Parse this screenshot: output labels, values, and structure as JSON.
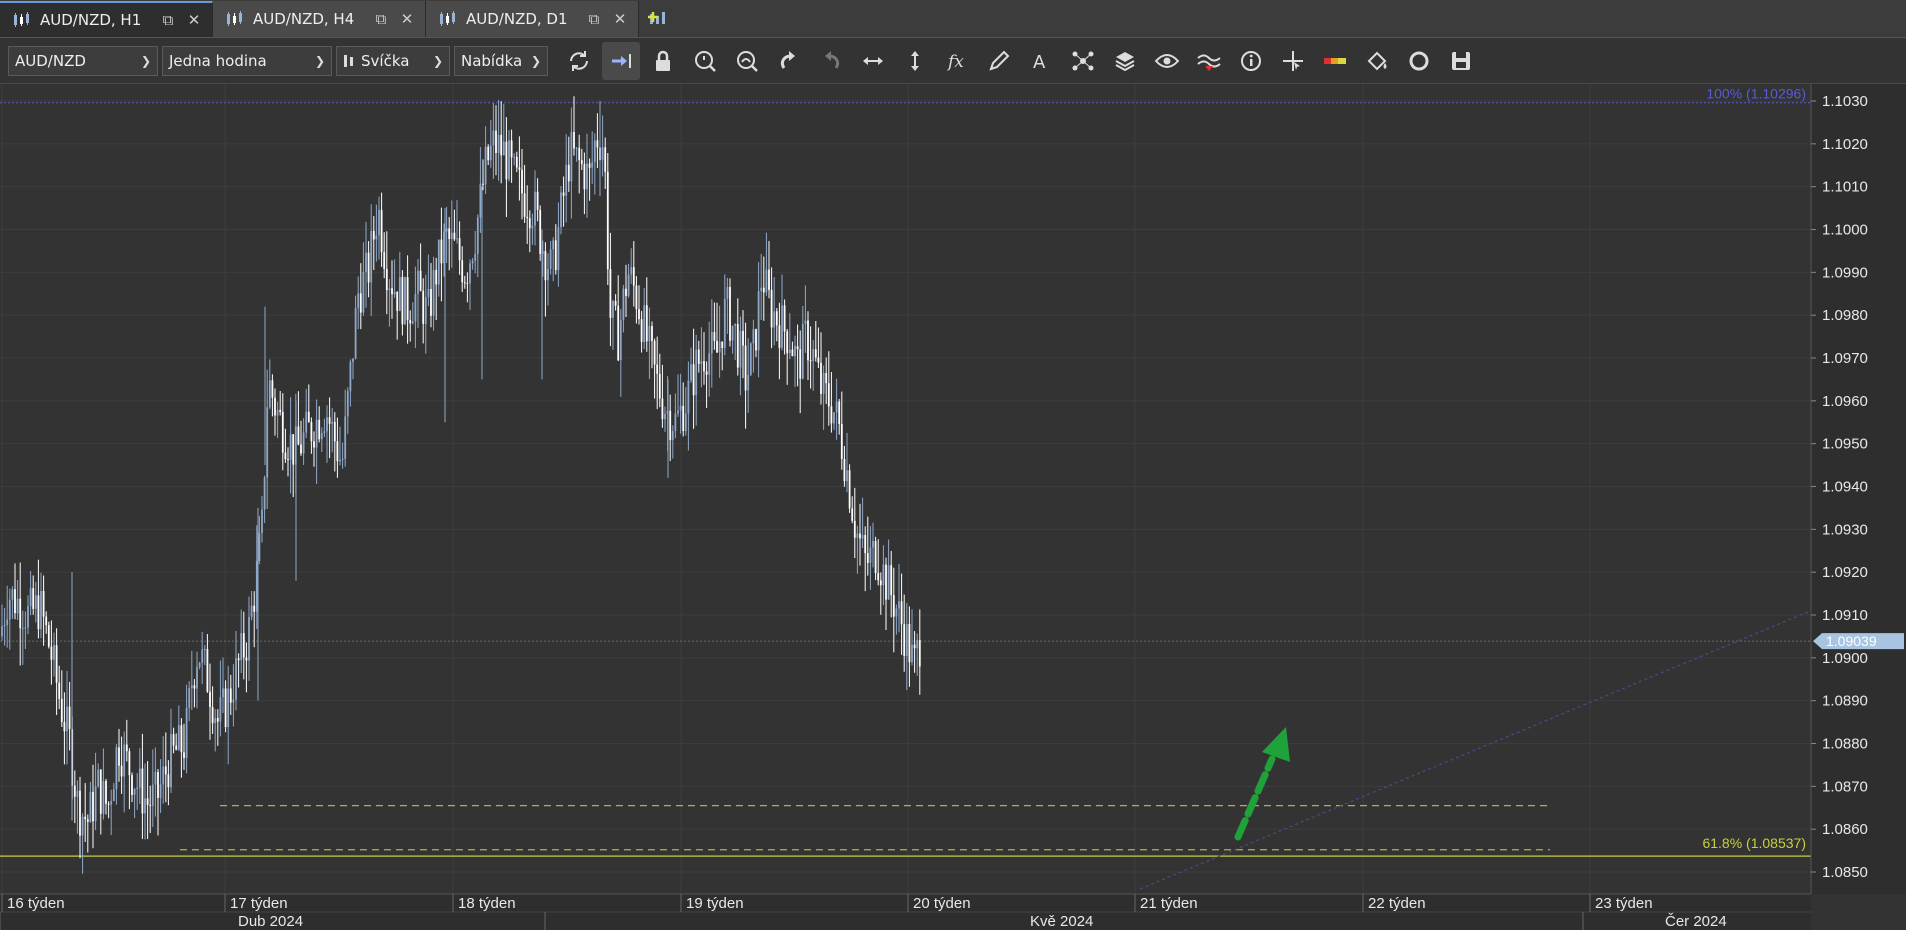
{
  "tabs": [
    {
      "label": "AUD/NZD, H1",
      "active": true
    },
    {
      "label": "AUD/NZD, H4",
      "active": false
    },
    {
      "label": "AUD/NZD, D1",
      "active": false
    }
  ],
  "toolbar": {
    "instrument": "AUD/NZD",
    "period": "Jedna hodina",
    "chart_type": "Svíčka",
    "offer_side": "Nabídka"
  },
  "icons": [
    "refresh-icon",
    "shift-chart-icon",
    "lock-icon",
    "zoom-in-icon",
    "zoom-out-icon",
    "undo-icon",
    "redo-icon",
    "fit-horizontal-icon",
    "fit-vertical-icon",
    "indicators-icon",
    "pencil-icon",
    "text-icon",
    "objects-icon",
    "layers-icon",
    "eye-icon",
    "signals-icon",
    "info-icon",
    "crosshair-icon",
    "ruler-icon",
    "theme-icon",
    "reset-icon",
    "save-icon"
  ],
  "colors": {
    "background": "#333333",
    "candle_up": "#8fa8c8",
    "candle_down": "#ffffff",
    "fib_100": "#5a5ad8",
    "fib_618": "#c8d040",
    "current_price_bg": "#a8c4e0",
    "arrow": "#1fa23a"
  },
  "chart_data": {
    "type": "candlestick",
    "price_labels": [
      "1.1030",
      "1.1020",
      "1.1010",
      "1.1000",
      "1.0990",
      "1.0980",
      "1.0970",
      "1.0960",
      "1.0950",
      "1.0940",
      "1.0930",
      "1.0920",
      "1.0910",
      "1.0900",
      "1.0890",
      "1.0880",
      "1.0870",
      "1.0860",
      "1.0850"
    ],
    "ylim": [
      1.0845,
      1.1035
    ],
    "current_price": "1.09039",
    "fib_100_label": "100% (1.10296)",
    "fib_100_value": 1.10296,
    "fib_618_label": "61.8% (1.08537)",
    "fib_618_value": 1.08537,
    "weeks": [
      "16 týden",
      "17 týden",
      "18 týden",
      "19 týden",
      "20 týden",
      "21 týden",
      "22 týden",
      "23 týden"
    ],
    "months": [
      "Dub 2024",
      "Kvě 2024",
      "Čer 2024"
    ],
    "path": [
      [
        0,
        1.0905
      ],
      [
        8,
        1.0915
      ],
      [
        18,
        1.0913
      ],
      [
        28,
        1.091
      ],
      [
        40,
        1.0912
      ],
      [
        52,
        1.09
      ],
      [
        60,
        1.089
      ],
      [
        70,
        1.088
      ],
      [
        78,
        1.0865
      ],
      [
        88,
        1.0862
      ],
      [
        98,
        1.087
      ],
      [
        108,
        1.0865
      ],
      [
        118,
        1.088
      ],
      [
        128,
        1.0875
      ],
      [
        138,
        1.087
      ],
      [
        148,
        1.0866
      ],
      [
        158,
        1.0868
      ],
      [
        168,
        1.0875
      ],
      [
        175,
        1.0878
      ],
      [
        185,
        1.088
      ],
      [
        192,
        1.0895
      ],
      [
        198,
        1.0902
      ],
      [
        208,
        1.0895
      ],
      [
        218,
        1.0885
      ],
      [
        228,
        1.089
      ],
      [
        238,
        1.0898
      ],
      [
        248,
        1.0905
      ],
      [
        256,
        1.0918
      ],
      [
        262,
        1.093
      ],
      [
        268,
        1.0965
      ],
      [
        276,
        1.0958
      ],
      [
        286,
        1.0952
      ],
      [
        296,
        1.0948
      ],
      [
        306,
        1.0952
      ],
      [
        316,
        1.0955
      ],
      [
        326,
        1.0958
      ],
      [
        336,
        1.095
      ],
      [
        342,
        1.0945
      ],
      [
        350,
        1.0965
      ],
      [
        358,
        1.0985
      ],
      [
        368,
        1.099
      ],
      [
        378,
        1.1005
      ],
      [
        388,
        1.099
      ],
      [
        398,
        1.0985
      ],
      [
        408,
        1.0982
      ],
      [
        418,
        1.0985
      ],
      [
        428,
        1.098
      ],
      [
        436,
        1.099
      ],
      [
        446,
        1.0998
      ],
      [
        456,
        1.0995
      ],
      [
        466,
        1.099
      ],
      [
        476,
        1.1
      ],
      [
        486,
        1.1015
      ],
      [
        494,
        1.102
      ],
      [
        504,
        1.1018
      ],
      [
        514,
        1.1012
      ],
      [
        524,
        1.1008
      ],
      [
        534,
        1.1005
      ],
      [
        544,
        1.0995
      ],
      [
        552,
        1.099
      ],
      [
        560,
        1.1002
      ],
      [
        570,
        1.1018
      ],
      [
        580,
        1.1015
      ],
      [
        590,
        1.1012
      ],
      [
        596,
        1.1022
      ],
      [
        604,
        1.102
      ],
      [
        610,
        1.098
      ],
      [
        618,
        1.0975
      ],
      [
        628,
        1.099
      ],
      [
        636,
        1.0985
      ],
      [
        646,
        1.0975
      ],
      [
        656,
        1.0965
      ],
      [
        666,
        1.0958
      ],
      [
        676,
        1.0955
      ],
      [
        686,
        1.096
      ],
      [
        696,
        1.0968
      ],
      [
        706,
        1.0972
      ],
      [
        716,
        1.097
      ],
      [
        726,
        1.0982
      ],
      [
        736,
        1.0975
      ],
      [
        746,
        1.0965
      ],
      [
        754,
        1.0972
      ],
      [
        762,
        1.099
      ],
      [
        770,
        1.0982
      ],
      [
        780,
        1.0978
      ],
      [
        790,
        1.0975
      ],
      [
        798,
        1.0968
      ],
      [
        806,
        1.0975
      ],
      [
        814,
        1.097
      ],
      [
        822,
        1.0962
      ],
      [
        830,
        1.096
      ],
      [
        838,
        1.0955
      ],
      [
        846,
        1.0945
      ],
      [
        856,
        1.093
      ],
      [
        866,
        1.0922
      ],
      [
        876,
        1.0925
      ],
      [
        886,
        1.0918
      ],
      [
        896,
        1.0912
      ],
      [
        906,
        1.0905
      ],
      [
        914,
        1.0898
      ],
      [
        920,
        1.0904
      ]
    ]
  }
}
